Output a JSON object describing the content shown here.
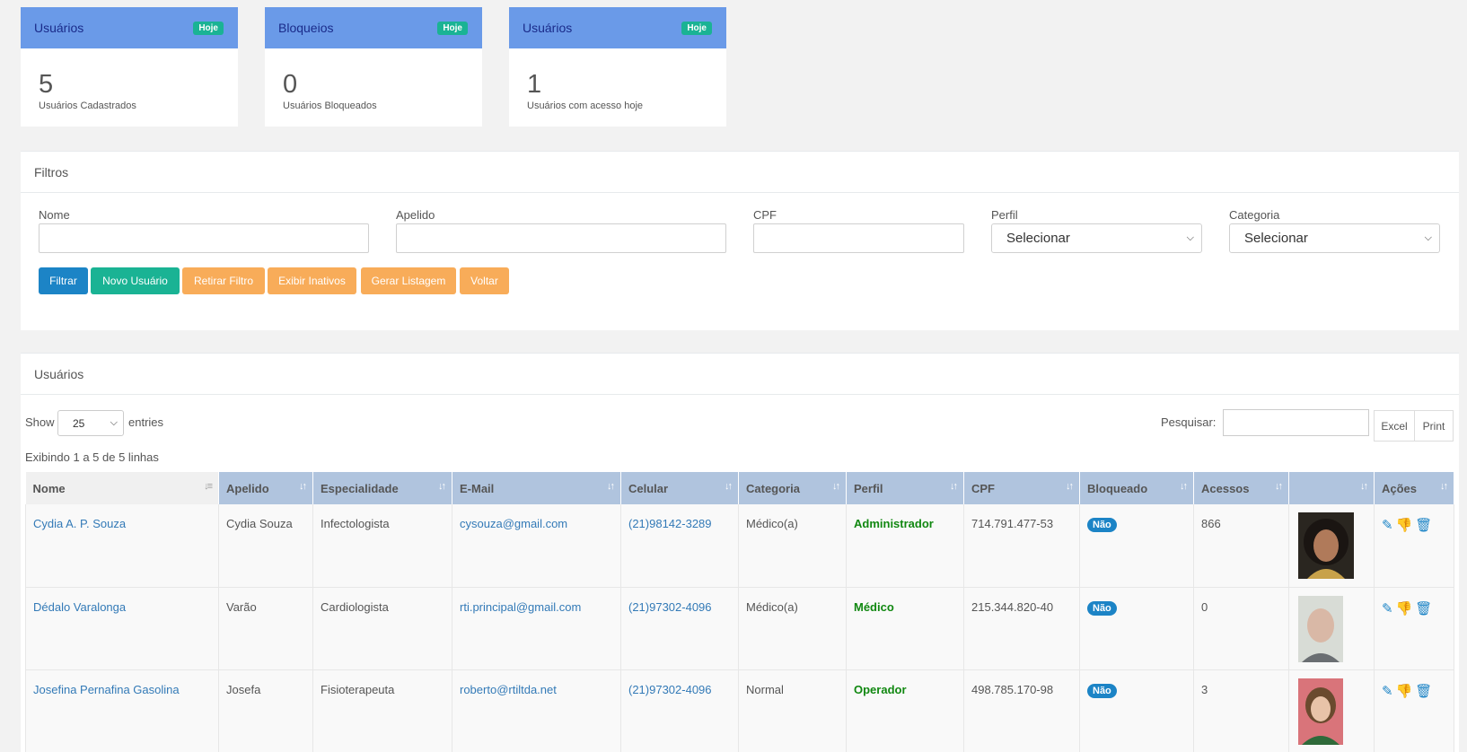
{
  "cards": [
    {
      "title": "Usuários",
      "badge": "Hoje",
      "value": "5",
      "subtitle": "Usuários Cadastrados"
    },
    {
      "title": "Bloqueios",
      "badge": "Hoje",
      "value": "0",
      "subtitle": "Usuários Bloqueados"
    },
    {
      "title": "Usuários",
      "badge": "Hoje",
      "value": "1",
      "subtitle": "Usuários com acesso hoje"
    }
  ],
  "filters": {
    "title": "Filtros",
    "nome_label": "Nome",
    "apelido_label": "Apelido",
    "cpf_label": "CPF",
    "perfil_label": "Perfil",
    "perfil_value": "Selecionar",
    "categoria_label": "Categoria",
    "categoria_value": "Selecionar",
    "buttons": {
      "filtrar": "Filtrar",
      "novo": "Novo Usuário",
      "retirar": "Retirar Filtro",
      "inativos": "Exibir Inativos",
      "listagem": "Gerar Listagem",
      "voltar": "Voltar"
    }
  },
  "users_panel": {
    "title": "Usuários",
    "show_label": "Show",
    "show_value": "25",
    "entries_label": "entries",
    "search_label": "Pesquisar:",
    "excel": "Excel",
    "print": "Print",
    "info": "Exibindo 1 a 5 de 5 linhas",
    "columns": [
      "Nome",
      "Apelido",
      "Especialidade",
      "E-Mail",
      "Celular",
      "Categoria",
      "Perfil",
      "CPF",
      "Bloqueado",
      "Acessos",
      "",
      "Ações"
    ],
    "rows": [
      {
        "nome": "Cydia A. P. Souza",
        "apelido": "Cydia Souza",
        "especialidade": "Infectologista",
        "email": "cysouza@gmail.com",
        "celular": "(21)98142-3289",
        "categoria": "Médico(a)",
        "perfil": "Administrador",
        "cpf": "714.791.477-53",
        "bloqueado": "Não",
        "acessos": "866"
      },
      {
        "nome": "Dédalo Varalonga",
        "apelido": "Varão",
        "especialidade": "Cardiologista",
        "email": "rti.principal@gmail.com",
        "celular": "(21)97302-4096",
        "categoria": "Médico(a)",
        "perfil": "Médico",
        "cpf": "215.344.820-40",
        "bloqueado": "Não",
        "acessos": "0"
      },
      {
        "nome": "Josefina Pernafina Gasolina",
        "apelido": "Josefa",
        "especialidade": "Fisioterapeuta",
        "email": "roberto@rtiltda.net",
        "celular": "(21)97302-4096",
        "categoria": "Normal",
        "perfil": "Operador",
        "cpf": "498.785.170-98",
        "bloqueado": "Não",
        "acessos": "3"
      }
    ]
  },
  "colors": {
    "card_header": "#6a9ae8",
    "badge": "#1ab394",
    "primary": "#1c84c6",
    "warning": "#f8ac59",
    "table_header": "#b0c4de",
    "perfil_green": "#118811"
  }
}
